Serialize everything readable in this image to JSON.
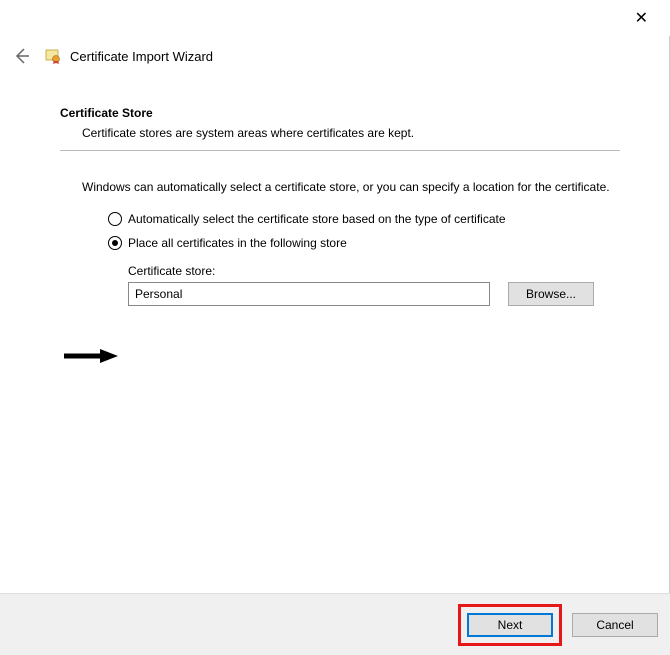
{
  "wizard": {
    "title": "Certificate Import Wizard"
  },
  "section": {
    "heading": "Certificate Store",
    "description": "Certificate stores are system areas where certificates are kept.",
    "body": "Windows can automatically select a certificate store, or you can specify a location for the certificate."
  },
  "options": {
    "auto": "Automatically select the certificate store based on the type of certificate",
    "manual": "Place all certificates in the following store"
  },
  "store": {
    "label": "Certificate store:",
    "value": "Personal",
    "browse": "Browse..."
  },
  "footer": {
    "next": "Next",
    "cancel": "Cancel"
  }
}
